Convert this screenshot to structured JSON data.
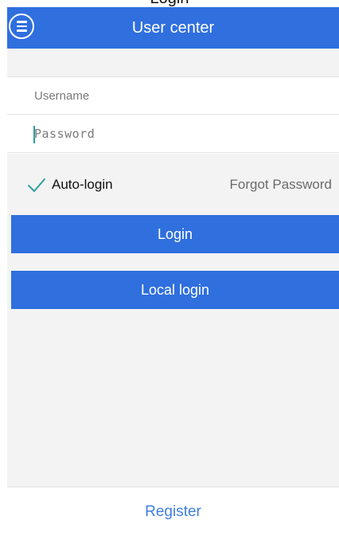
{
  "status_bar": {
    "cut_text": "Login"
  },
  "header": {
    "title": "User center",
    "menu_icon": "menu-icon",
    "color": "#2f6fde"
  },
  "login_form": {
    "username": {
      "value": "",
      "placeholder": "Username"
    },
    "password": {
      "value": "",
      "placeholder": "Password"
    },
    "auto_login": {
      "label": "Auto-login",
      "checked": true,
      "icon": "check-icon"
    },
    "forgot_password_label": "Forgot Password",
    "login_button_label": "Login",
    "local_login_button_label": "Local login"
  },
  "footer": {
    "register_label": "Register",
    "link_color": "#3f7fe0"
  }
}
